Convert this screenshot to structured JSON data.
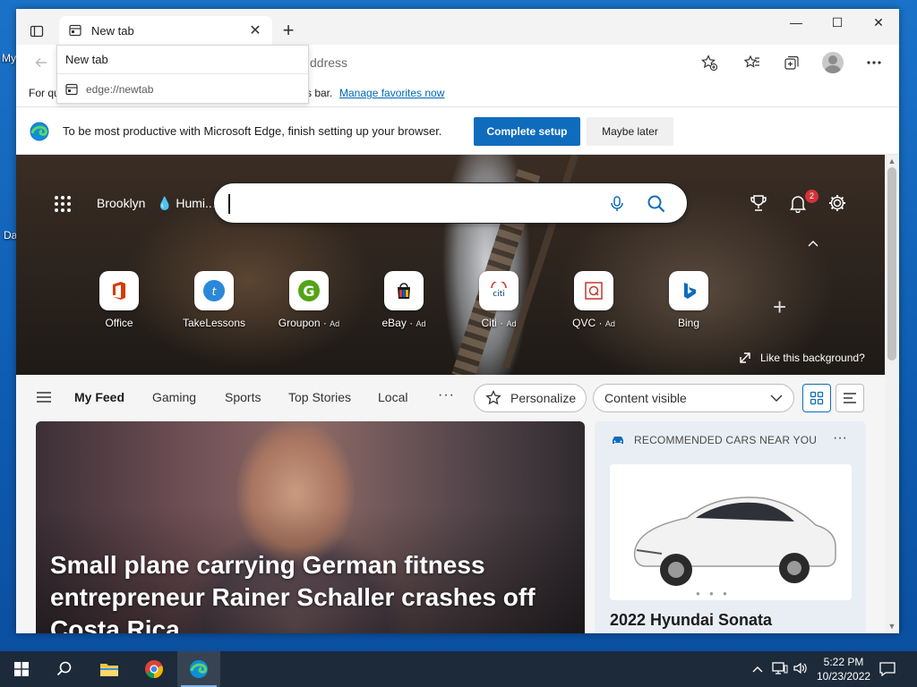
{
  "desktop": {
    "icon_labels": [
      "My",
      "Da"
    ]
  },
  "browser": {
    "tab": {
      "title": "New tab",
      "close_glyph": "✕"
    },
    "new_tab_glyph": "+",
    "window_controls": {
      "minimize": "—",
      "maximize": "☐",
      "close": "✕"
    },
    "address": {
      "placeholder_partial": "ddress"
    },
    "dropdown": {
      "suggestion_title": "New tab",
      "suggestion_url": "edge://newtab"
    },
    "favorites_bar": {
      "prefix": "For qu",
      "middle": "s bar.",
      "manage_link": "Manage favorites now"
    },
    "setup_bar": {
      "message": "To be most productive with Microsoft Edge, finish setting up your browser.",
      "complete_label": "Complete setup",
      "later_label": "Maybe later"
    }
  },
  "newtab": {
    "location": "Brooklyn",
    "weather": "Humi...",
    "notification_count": "2",
    "quick_links": [
      {
        "label": "Office",
        "ad": "",
        "icon": "office-icon"
      },
      {
        "label": "TakeLessons",
        "ad": "",
        "icon": "takelessons-icon"
      },
      {
        "label": "Groupon",
        "ad": "Ad",
        "icon": "groupon-icon"
      },
      {
        "label": "eBay",
        "ad": "Ad",
        "icon": "ebay-icon"
      },
      {
        "label": "Citi",
        "ad": "Ad",
        "icon": "citi-icon"
      },
      {
        "label": "QVC",
        "ad": "Ad",
        "icon": "qvc-icon"
      },
      {
        "label": "Bing",
        "ad": "",
        "icon": "bing-icon"
      }
    ],
    "add_glyph": "+",
    "like_background": "Like this background?",
    "feed": {
      "tabs": [
        "My Feed",
        "Gaming",
        "Sports",
        "Top Stories",
        "Local"
      ],
      "more": "···",
      "personalize": "Personalize",
      "content_select": "Content visible"
    },
    "story": {
      "headline": "Small plane carrying German fitness entrepreneur Rainer Schaller crashes off Costa Rica"
    },
    "cars_card": {
      "header": "RECOMMENDED CARS NEAR YOU",
      "more": "···",
      "title": "2022 Hyundai Sonata"
    }
  },
  "taskbar": {
    "time": "5:22 PM",
    "date": "10/23/2022"
  },
  "colors": {
    "accent": "#0f6cbd",
    "link": "#0067b8",
    "badge": "#d13438",
    "taskbar": "#1c2a3a",
    "desktop": "#1a73c9"
  }
}
